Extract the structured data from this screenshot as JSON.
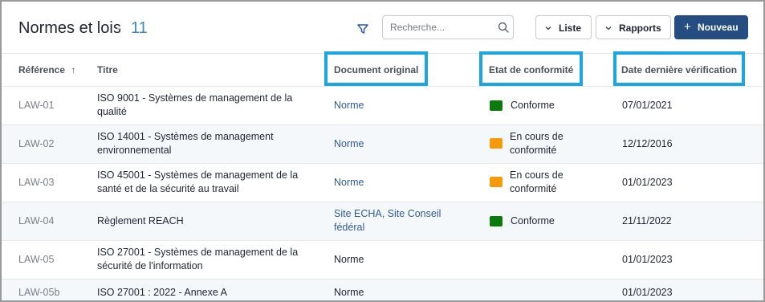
{
  "header": {
    "title": "Normes et lois",
    "separator": "-",
    "count": "11",
    "filter_icon": "filter-icon",
    "search": {
      "placeholder": "Recherche...",
      "value": "",
      "icon": "search-icon"
    },
    "list_button": "Liste",
    "reports_button": "Rapports",
    "new_button": "Nouveau",
    "new_icon": "+"
  },
  "table": {
    "columns": {
      "reference": "Référence",
      "sort_arrow": "↑",
      "title": "Titre",
      "document": "Document original",
      "status": "Etat de conformité",
      "date": "Date dernière vérification"
    },
    "rows": [
      {
        "ref": "LAW-01",
        "title_l1": "ISO 9001 - Systèmes de management de la",
        "title_l2": "qualité",
        "doc_l1": "Norme",
        "doc_l2": "",
        "doc_link": true,
        "status_l1": "Conforme",
        "status_l2": "",
        "status_color": "#0d7a0d",
        "date": "07/01/2021"
      },
      {
        "ref": "LAW-02",
        "title_l1": "ISO 14001 - Systèmes de management",
        "title_l2": "environnemental",
        "doc_l1": "Norme",
        "doc_l2": "",
        "doc_link": true,
        "status_l1": "En cours de",
        "status_l2": "conformité",
        "status_color": "#f59a0a",
        "date": "12/12/2016"
      },
      {
        "ref": "LAW-03",
        "title_l1": "ISO 45001 - Systèmes de management de la",
        "title_l2": "santé et de la sécurité au travail",
        "doc_l1": "Norme",
        "doc_l2": "",
        "doc_link": true,
        "status_l1": "En cours de",
        "status_l2": "conformité",
        "status_color": "#f59a0a",
        "date": "01/01/2023"
      },
      {
        "ref": "LAW-04",
        "title_l1": "Règlement REACH",
        "title_l2": "",
        "doc_l1": "Site ECHA, Site Conseil",
        "doc_l2": "fédéral",
        "doc_link": true,
        "status_l1": "Conforme",
        "status_l2": "",
        "status_color": "#0d7a0d",
        "date": "21/11/2022"
      },
      {
        "ref": "LAW-05",
        "title_l1": "ISO 27001 - Systèmes de management de la",
        "title_l2": "sécurité de l'information",
        "doc_l1": "Norme",
        "doc_l2": "",
        "doc_link": false,
        "status_l1": "",
        "status_l2": "",
        "status_color": "",
        "date": "01/01/2023"
      },
      {
        "ref": "LAW-05b",
        "title_l1": "ISO 27001 : 2022 - Annexe A",
        "title_l2": "",
        "doc_l1": "Norme",
        "doc_l2": "",
        "doc_link": false,
        "status_l1": "",
        "status_l2": "",
        "status_color": "",
        "date": "01/01/2023"
      }
    ]
  },
  "colors": {
    "accent": "#3c86c4",
    "primary_button": "#264d82",
    "highlight_box": "#1aa7e1",
    "link": "#2f5b93"
  }
}
